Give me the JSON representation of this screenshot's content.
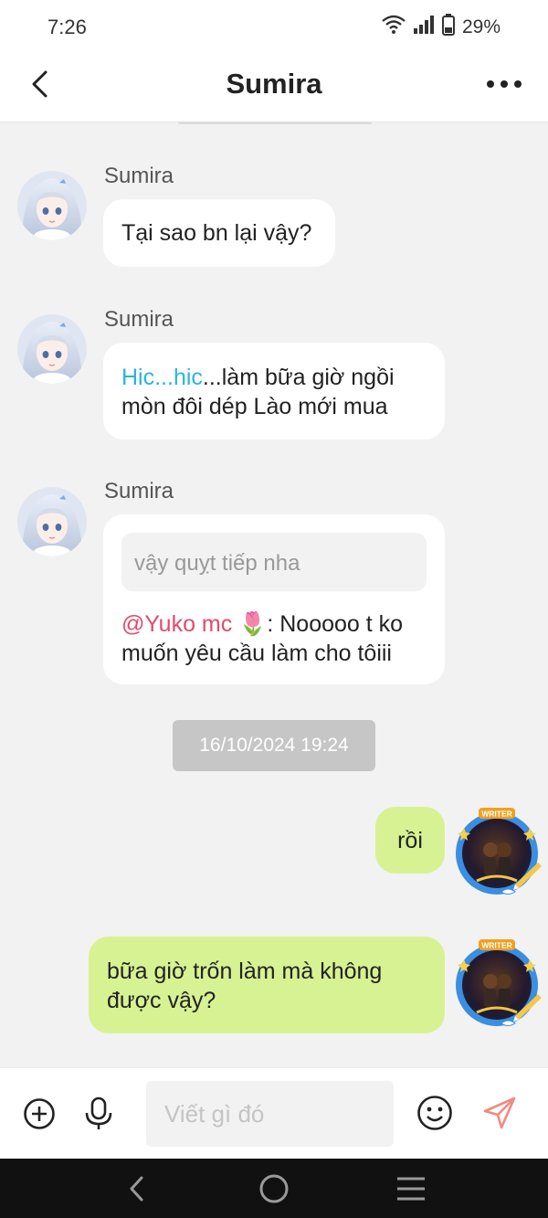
{
  "status": {
    "time": "7:26",
    "battery_text": "29%"
  },
  "header": {
    "title": "Sumira"
  },
  "messages": [
    {
      "sender": "Sumira",
      "text": "Tại sao bn lại vậy?"
    },
    {
      "sender": "Sumira",
      "link_text": "Hic...hic",
      "line1_rest": "...làm bữa giờ ngồi",
      "line2": "mòn đôi dép Lào mới mua"
    },
    {
      "sender": "Sumira",
      "quote": "vậy quỵt tiếp nha",
      "mention": "@Yuko mc",
      "emoji": "🌷",
      "line1_rest": ": Nooooo t ko",
      "line2": "muốn yêu cầu làm cho tôiii"
    }
  ],
  "timestamp": "16/10/2024 19:24",
  "outgoing": [
    {
      "text": "rồi",
      "badge": "WRITER"
    },
    {
      "line1": "bữa giờ trốn làm mà không",
      "line2": "được vậy?",
      "badge": "WRITER"
    }
  ],
  "input": {
    "placeholder": "Viết gì đó"
  },
  "colors": {
    "outgoing_bubble": "#d7f293",
    "link": "#2bb5d8",
    "mention": "#e24b6a",
    "send": "#f08a80"
  },
  "icons": [
    "back-icon",
    "more-icon",
    "plus-icon",
    "mic-icon",
    "emoji-icon",
    "send-icon",
    "wifi-icon",
    "signal-icon",
    "battery-icon",
    "nav-back-icon",
    "nav-home-icon",
    "nav-recents-icon"
  ]
}
